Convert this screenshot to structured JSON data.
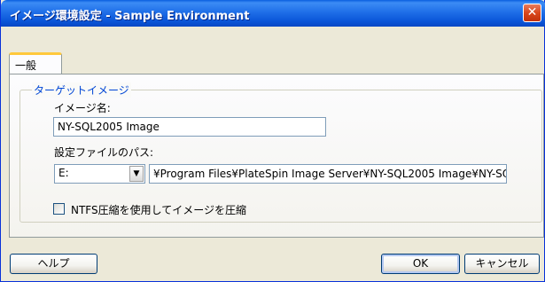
{
  "window": {
    "title": "イメージ環境設定 - Sample Environment",
    "close_glyph": "✕"
  },
  "tabs": [
    {
      "label": "一般",
      "selected": true
    }
  ],
  "target_group": {
    "legend": "ターゲットイメージ",
    "image_name_label": "イメージ名:",
    "image_name_value": "NY-SQL2005 Image",
    "config_path_label": "設定ファイルのパス:",
    "drive_value": "E:",
    "path_value": "¥Program Files¥PlateSpin Image Server¥NY-SQL2005 Image¥NY-SQ",
    "ntfs_checkbox_label": "NTFS圧縮を使用してイメージを圧縮",
    "ntfs_checked": false
  },
  "buttons": {
    "help": "ヘルプ",
    "ok": "OK",
    "cancel": "キャンセル"
  },
  "colors": {
    "titlebar": "#0a55d8",
    "window_bg": "#ece9d8",
    "legend_text": "#0046d5",
    "tab_highlight": "#ffc83c"
  }
}
